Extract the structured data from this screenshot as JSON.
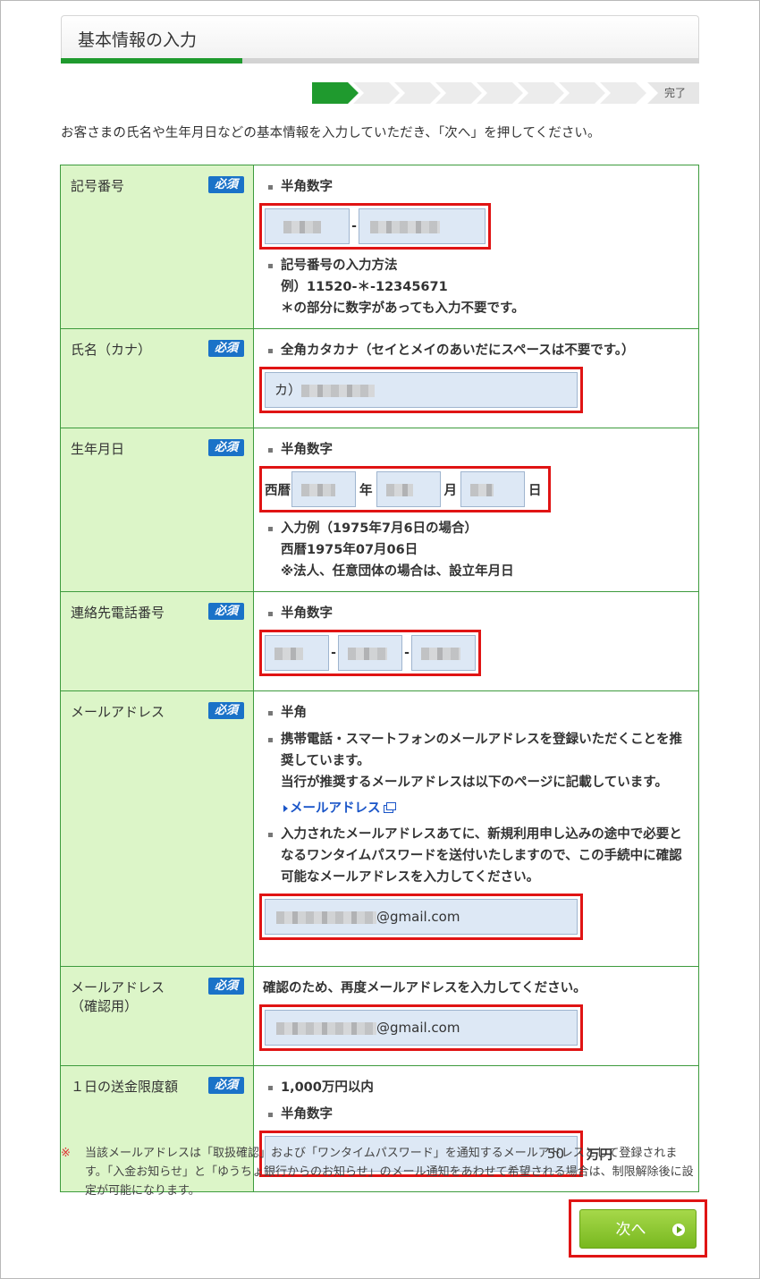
{
  "page_title": "基本情報の入力",
  "steps": {
    "total": 9,
    "current": 1,
    "done_label": "完了"
  },
  "intro": "お客さまの氏名や生年月日などの基本情報を入力していただき、「次へ」を押してください。",
  "required_label": "必須",
  "rows": {
    "account": {
      "label": "記号番号",
      "hint": "半角数字",
      "dash": "-",
      "howto_title": "記号番号の入力方法",
      "howto_example": "例）11520-＊-12345671",
      "howto_note": "＊の部分に数字があっても入力不要です。"
    },
    "name": {
      "label": "氏名（カナ）",
      "hint": "全角カタカナ（セイとメイのあいだにスペースは不要です。）",
      "value_prefix": "カ）"
    },
    "birth": {
      "label": "生年月日",
      "hint": "半角数字",
      "era": "西暦",
      "year": "年",
      "month": "月",
      "day": "日",
      "example_title": "入力例（1975年7月6日の場合）",
      "example_value": "西暦1975年07月06日",
      "example_note": "※法人、任意団体の場合は、設立年月日"
    },
    "phone": {
      "label": "連絡先電話番号",
      "hint": "半角数字",
      "dash": "-"
    },
    "email": {
      "label": "メールアドレス",
      "hint": "半角",
      "mobile_note_1": "携帯電話・スマートフォンのメールアドレスを登録いただくことを推奨しています。",
      "mobile_note_2": "当行が推奨するメールアドレスは以下のページに記載しています。",
      "link_text": "メールアドレス",
      "otp_note": "入力されたメールアドレスあてに、新規利用申し込みの途中で必要となるワンタイムパスワードを送付いたしますので、この手続中に確認可能なメールアドレスを入力してください。",
      "value_suffix": "@gmail.com"
    },
    "email_confirm": {
      "label": "メールアドレス",
      "label_sub": "（確認用）",
      "hint": "確認のため、再度メールアドレスを入力してください。",
      "value_suffix": "@gmail.com"
    },
    "limit": {
      "label": "１日の送金限度額",
      "hint_1": "1,000万円以内",
      "hint_2": "半角数字",
      "value": "50",
      "unit": "万円"
    }
  },
  "footnote_mark": "※",
  "footnote": "当該メールアドレスは「取扱確認」および「ワンタイムパスワード」を通知するメールアドレスとして登録されます。「入金お知らせ」と「ゆうちょ銀行からのお知らせ」のメール通知をあわせて希望される場合は、制限解除後に設定が可能になります。",
  "next_button": "次へ",
  "colors": {
    "accent_green": "#1f9a2e",
    "label_bg": "#dcf5c8",
    "required_badge": "#1a72c8",
    "highlight_red": "#e01414"
  }
}
